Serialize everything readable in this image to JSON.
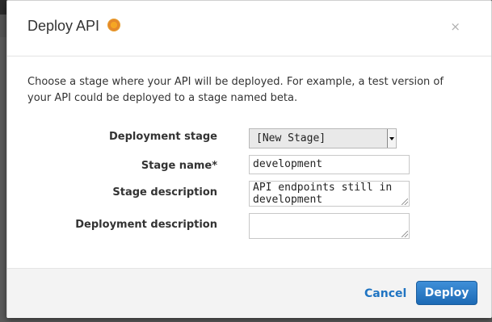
{
  "dialog": {
    "title": "Deploy API",
    "title_icon": "status-circle-icon",
    "close_label": "×",
    "description": "Choose a stage where your API will be deployed. For example, a test version of your API could be deployed to a stage named beta."
  },
  "form": {
    "deployment_stage_label": "Deployment stage",
    "deployment_stage_value": "[New Stage]",
    "stage_name_label": "Stage name*",
    "stage_name_value": "development",
    "stage_description_label": "Stage description",
    "stage_description_value": "API endpoints still in development",
    "deployment_description_label": "Deployment description",
    "deployment_description_value": ""
  },
  "footer": {
    "cancel_label": "Cancel",
    "deploy_label": "Deploy"
  },
  "colors": {
    "primary_button": "#1c6ab5",
    "link": "#1f74c2"
  }
}
